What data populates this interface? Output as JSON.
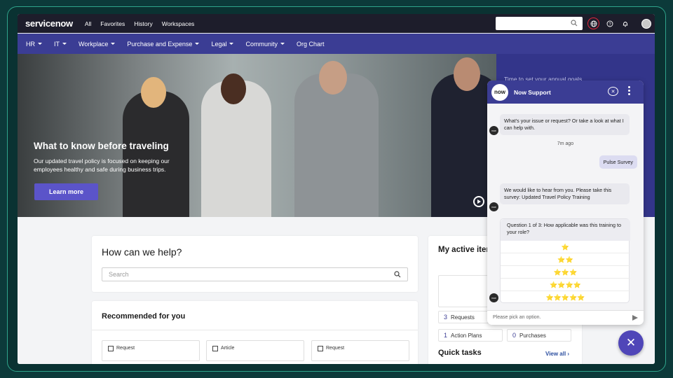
{
  "topbar": {
    "logo": "servicenow",
    "nav": [
      "All",
      "Favorites",
      "History",
      "Workspaces"
    ],
    "search_placeholder": ""
  },
  "subnav": [
    {
      "label": "HR",
      "dropdown": true
    },
    {
      "label": "IT",
      "dropdown": true
    },
    {
      "label": "Workplace",
      "dropdown": true
    },
    {
      "label": "Purchase and Expense",
      "dropdown": true
    },
    {
      "label": "Legal",
      "dropdown": true
    },
    {
      "label": "Community",
      "dropdown": true
    },
    {
      "label": "Org Chart",
      "dropdown": false
    }
  ],
  "hero": {
    "title": "What to know before traveling",
    "description": "Our updated travel policy is focused on keeping our employees healthy and safe during business trips.",
    "button": "Learn more",
    "side_text": "Time to set your annual goals"
  },
  "help": {
    "title": "How can we help?",
    "search_placeholder": "Search"
  },
  "recommended": {
    "title": "Recommended for you",
    "items": [
      "Request",
      "Article",
      "Request"
    ]
  },
  "active_items": {
    "title": "My active items",
    "requests_count": "3",
    "requests_label": "Requests",
    "action_plans_count": "1",
    "action_plans_label": "Action Plans",
    "purchases_count": "0",
    "purchases_label": "Purchases"
  },
  "quick_tasks": {
    "title": "Quick tasks",
    "view_all": "View all"
  },
  "chat": {
    "logo": "now",
    "title": "Now Support",
    "msg1": "What's your issue or request? Or take a look at what I can help with.",
    "timestamp": "7m ago",
    "user_msg": "Pulse Survey",
    "msg2": "We would like to hear from you. Please take this survey: Updated Travel Policy Training",
    "survey_question": "Question 1 of 3: How applicable was this training to your role?",
    "star_options": [
      "⭐",
      "⭐⭐",
      "⭐⭐⭐",
      "⭐⭐⭐⭐",
      "⭐⭐⭐⭐⭐"
    ],
    "input_placeholder": "Please pick an option."
  },
  "fab_icon": "close-icon"
}
